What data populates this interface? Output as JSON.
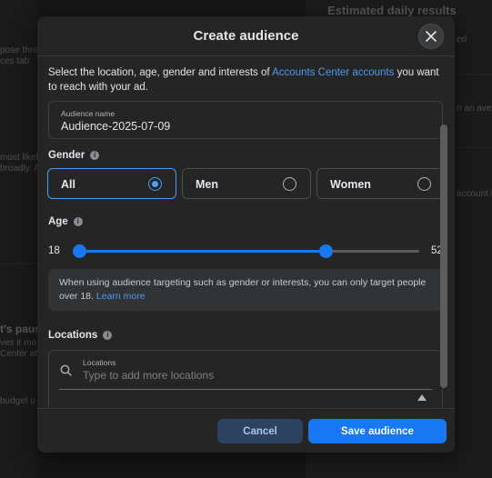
{
  "background": {
    "estimated_title": "Estimated daily results",
    "right_snippets": [
      "ed",
      "n an aver",
      "account to"
    ],
    "left_snippets": [
      "pose throu",
      "ces tab.",
      "most likel",
      "broadly. A",
      "t's paus",
      "ves it mo",
      "Center at a",
      "budget u"
    ]
  },
  "modal": {
    "title": "Create audience",
    "close_label": "Close",
    "intro_text": "Select the location, age, gender and interests of ",
    "intro_link": "Accounts Center accounts",
    "intro_suffix": " you want to reach with your ad.",
    "audience_name": {
      "label": "Audience name",
      "value": "Audience-2025-07-09"
    },
    "gender": {
      "label": "Gender",
      "options": [
        {
          "label": "All",
          "selected": true
        },
        {
          "label": "Men",
          "selected": false
        },
        {
          "label": "Women",
          "selected": false
        }
      ]
    },
    "age": {
      "label": "Age",
      "min": "18",
      "max": "52",
      "range_min": 18,
      "range_max": 65,
      "value_low": 18,
      "value_high": 52
    },
    "notice": {
      "text": "When using audience targeting such as gender or interests, you can only target people over 18. ",
      "link": "Learn more"
    },
    "locations": {
      "label": "Locations",
      "field_label": "Locations",
      "placeholder": "Type to add more locations"
    },
    "footer": {
      "cancel": "Cancel",
      "save": "Save audience"
    }
  },
  "colors": {
    "accent": "#1877f2",
    "link": "#4e9cf5",
    "modal_bg": "#252526",
    "page_bg": "#161617"
  }
}
